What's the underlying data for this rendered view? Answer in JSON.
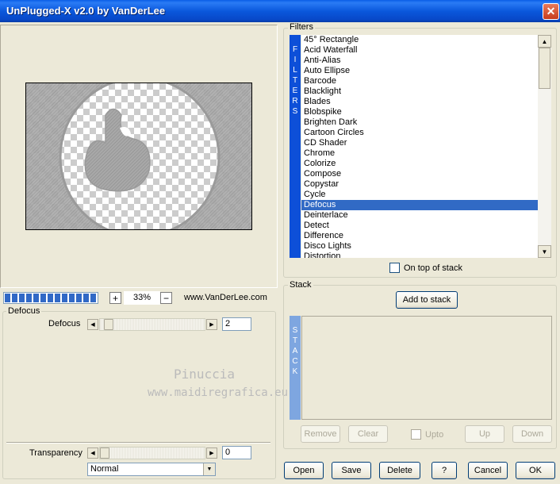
{
  "window": {
    "title": "UnPlugged-X v2.0 by VanDerLee",
    "close_glyph": "✕"
  },
  "preview": {
    "zoom_value": "33%",
    "zoom_plus": "+",
    "zoom_minus": "−",
    "website": "www.VanDerLee.com"
  },
  "defocus": {
    "group_label": "Defocus",
    "param_label": "Defocus",
    "param_value": "2",
    "transparency_label": "Transparency",
    "transparency_value": "0",
    "blend_mode": "Normal",
    "watermark_line1": "Pinuccia",
    "watermark_line2": "www.maidiregrafica.eu"
  },
  "filters": {
    "group_label": "Filters",
    "side_label": [
      "F",
      "I",
      "L",
      "T",
      "E",
      "R",
      "S"
    ],
    "items": [
      "45° Rectangle",
      "Acid Waterfall",
      "Anti-Alias",
      "Auto Ellipse",
      "Barcode",
      "Blacklight",
      "Blades",
      "Blobspike",
      "Brighten Dark",
      "Cartoon Circles",
      "CD Shader",
      "Chrome",
      "Colorize",
      "Compose",
      "Copystar",
      "Cycle",
      "Defocus",
      "Deinterlace",
      "Detect",
      "Difference",
      "Disco Lights",
      "Distortion"
    ],
    "selected": "Defocus",
    "on_top_label": "On top of stack"
  },
  "stack": {
    "group_label": "Stack",
    "side_label": [
      "S",
      "T",
      "A",
      "C",
      "K"
    ],
    "add_button": "Add to stack",
    "remove_button": "Remove",
    "clear_button": "Clear",
    "upto_label": "Upto",
    "up_button": "Up",
    "down_button": "Down"
  },
  "buttons": {
    "open": "Open",
    "save": "Save",
    "delete": "Delete",
    "help": "?",
    "cancel": "Cancel",
    "ok": "OK"
  }
}
